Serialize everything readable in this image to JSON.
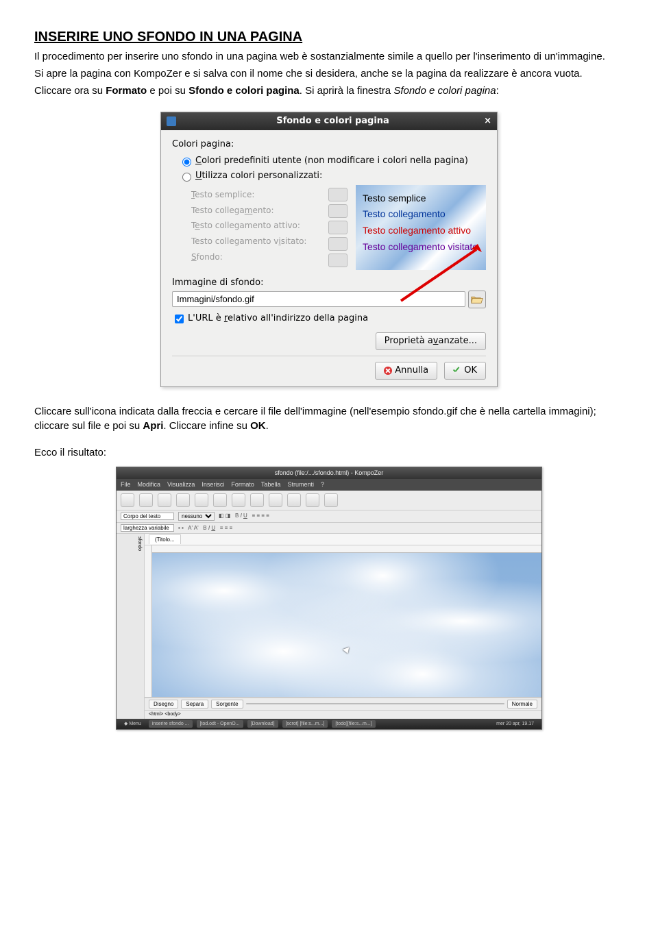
{
  "doc": {
    "heading": "INSERIRE UNO SFONDO IN UNA PAGINA",
    "intro1": "Il procedimento per inserire uno sfondo in una pagina web è sostanzialmente simile a quello per l'inserimento di un'immagine.",
    "intro2_a": "Si apre la pagina con KompoZer e si salva con il nome che si desidera, anche se la pagina da realizzare è ancora vuota.",
    "intro3_a": "Cliccare ora su ",
    "intro3_b": "Formato",
    "intro3_c": " e poi su ",
    "intro3_d": "Sfondo e colori pagina",
    "intro3_e": ". Si aprirà la finestra ",
    "intro3_f": "Sfondo e colori pagina",
    "intro3_g": ":",
    "after1": "Cliccare sull'icona indicata dalla freccia e cercare il file dell'immagine (nell'esempio sfondo.gif che è nella cartella immagini); cliccare sul file e poi su ",
    "after1_b": "Apri",
    "after1_c": ". Cliccare infine su ",
    "after1_d": "OK",
    "after1_e": ".",
    "result": "Ecco il risultato:"
  },
  "dialog": {
    "title": "Sfondo e colori pagina",
    "section": "Colori pagina:",
    "radio1_a": "C",
    "radio1_b": "olori predefiniti utente (non modificare i colori nella pagina)",
    "radio2_a": "U",
    "radio2_b": "tilizza colori personalizzati:",
    "labels": {
      "t1_a": "T",
      "t1_b": "esto semplice:",
      "t2_a": "Testo collega",
      "t2_b": "m",
      "t2_c": "ento:",
      "t3_a": "T",
      "t3_b": "e",
      "t3_c": "sto collegamento attivo:",
      "t4_a": "Testo collegamento v",
      "t4_b": "i",
      "t4_c": "sitato:",
      "t5_a": "S",
      "t5_b": "fondo:"
    },
    "preview": {
      "l1": "Testo semplice",
      "l2": "Testo collegamento",
      "l3": "Testo collegamento attivo",
      "l4": "Testo collegamento visitato"
    },
    "bg_label_a": "Imma",
    "bg_label_b": "g",
    "bg_label_c": "ine di sfondo:",
    "bg_path": "Immagini/sfondo.gif",
    "url_rel_a": "L'URL è ",
    "url_rel_b": "r",
    "url_rel_c": "elativo all'indirizzo della pagina",
    "adv_a": "Proprietà a",
    "adv_b": "v",
    "adv_c": "anzate...",
    "cancel": "Annulla",
    "ok": "OK"
  },
  "kompozer": {
    "title": "sfondo (file:/.../sfondo.html) - KompoZer",
    "menus": [
      "File",
      "Modifica",
      "Visualizza",
      "Inserisci",
      "Formato",
      "Tabella",
      "Strumenti",
      "?"
    ],
    "tool2_label1": "Corpo del testo",
    "tool2_select": "nessuno",
    "width_label": "larghezza variabile",
    "tab": "(Titolo...",
    "sidebar": "sfondo",
    "bottom_tabs": [
      "Disegno",
      "Separa",
      "Sorgente"
    ],
    "bottom_right": "Normale",
    "status": "<html>  <body>",
    "taskbar_items": [
      "inserire sfondo ...",
      "[tod.odt - OpenO...",
      "[Download]",
      "[scrot] [file:s...m...]",
      "[todo][file:s...m...]"
    ],
    "taskbar_right": "mer 20 apr, 19.17"
  }
}
